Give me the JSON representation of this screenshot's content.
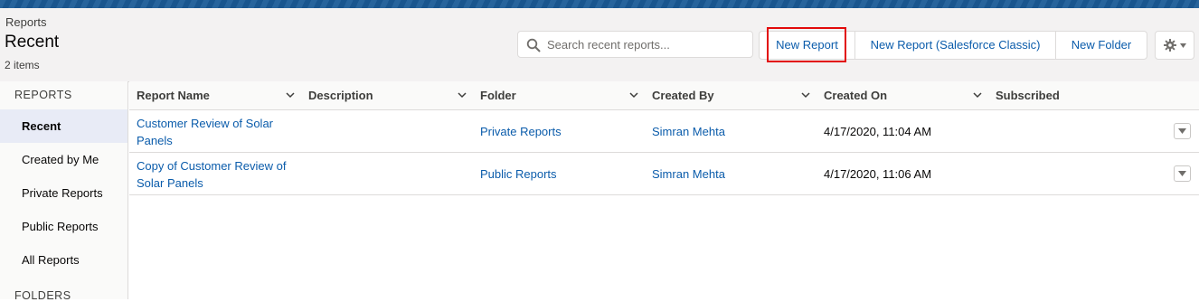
{
  "header": {
    "breadcrumb": "Reports",
    "title": "Recent",
    "count": "2 items"
  },
  "search": {
    "placeholder": "Search recent reports...",
    "value": ""
  },
  "buttons": {
    "new_report": "New Report",
    "new_report_classic": "New Report (Salesforce Classic)",
    "new_folder": "New Folder"
  },
  "sidebar": {
    "reports_heading": "REPORTS",
    "items": [
      {
        "label": "Recent",
        "active": true
      },
      {
        "label": "Created by Me"
      },
      {
        "label": "Private Reports"
      },
      {
        "label": "Public Reports"
      },
      {
        "label": "All Reports"
      }
    ],
    "folders_heading": "FOLDERS"
  },
  "table": {
    "columns": [
      "Report Name",
      "Description",
      "Folder",
      "Created By",
      "Created On",
      "Subscribed"
    ],
    "rows": [
      {
        "name_line1": "Customer Review of Solar",
        "name_line2": "Panels",
        "description": "",
        "folder": "Private Reports",
        "created_by": "Simran Mehta",
        "created_on": "4/17/2020, 11:04 AM",
        "subscribed": ""
      },
      {
        "name_line1": "Copy of Customer Review of",
        "name_line2": "Solar Panels",
        "description": "",
        "folder": "Public Reports",
        "created_by": "Simran Mehta",
        "created_on": "4/17/2020, 11:06 AM",
        "subscribed": ""
      }
    ]
  },
  "colors": {
    "brand_band": "#1a5a96",
    "link": "#0b5cab",
    "highlight_box": "#e20b0b",
    "active_nav_bg": "#e8ebf6"
  },
  "icons": {
    "search": "search-icon",
    "settings": "gear-icon",
    "column_sort": "chevron-down-icon",
    "row_actions": "caret-down-icon"
  }
}
